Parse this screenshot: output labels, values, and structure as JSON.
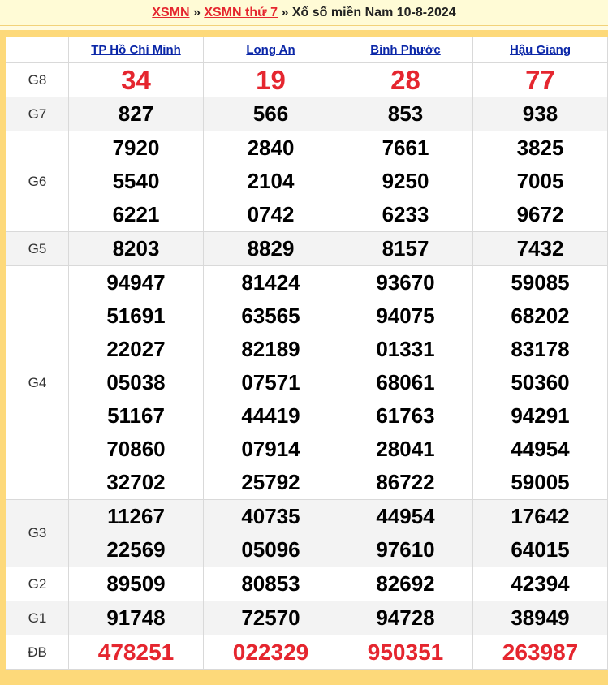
{
  "breadcrumb": {
    "home": "XSMN",
    "sep1": " » ",
    "day": "XSMN thứ 7",
    "sep2": " » ",
    "title": "Xổ số miền Nam 10-8-2024"
  },
  "provinces": [
    "TP Hồ Chí Minh",
    "Long An",
    "Bình Phước",
    "Hậu Giang"
  ],
  "rows": [
    {
      "label": "G8",
      "values": [
        [
          "34"
        ],
        [
          "19"
        ],
        [
          "28"
        ],
        [
          "77"
        ]
      ]
    },
    {
      "label": "G7",
      "values": [
        [
          "827"
        ],
        [
          "566"
        ],
        [
          "853"
        ],
        [
          "938"
        ]
      ]
    },
    {
      "label": "G6",
      "values": [
        [
          "7920",
          "5540",
          "6221"
        ],
        [
          "2840",
          "2104",
          "0742"
        ],
        [
          "7661",
          "9250",
          "6233"
        ],
        [
          "3825",
          "7005",
          "9672"
        ]
      ]
    },
    {
      "label": "G5",
      "values": [
        [
          "8203"
        ],
        [
          "8829"
        ],
        [
          "8157"
        ],
        [
          "7432"
        ]
      ]
    },
    {
      "label": "G4",
      "values": [
        [
          "94947",
          "51691",
          "22027",
          "05038",
          "51167",
          "70860",
          "32702"
        ],
        [
          "81424",
          "63565",
          "82189",
          "07571",
          "44419",
          "07914",
          "25792"
        ],
        [
          "93670",
          "94075",
          "01331",
          "68061",
          "61763",
          "28041",
          "86722"
        ],
        [
          "59085",
          "68202",
          "83178",
          "50360",
          "94291",
          "44954",
          "59005"
        ]
      ]
    },
    {
      "label": "G3",
      "values": [
        [
          "11267",
          "22569"
        ],
        [
          "40735",
          "05096"
        ],
        [
          "44954",
          "97610"
        ],
        [
          "17642",
          "64015"
        ]
      ]
    },
    {
      "label": "G2",
      "values": [
        [
          "89509"
        ],
        [
          "80853"
        ],
        [
          "82692"
        ],
        [
          "42394"
        ]
      ]
    },
    {
      "label": "G1",
      "values": [
        [
          "91748"
        ],
        [
          "72570"
        ],
        [
          "94728"
        ],
        [
          "38949"
        ]
      ]
    },
    {
      "label": "ĐB",
      "values": [
        [
          "478251"
        ],
        [
          "022329"
        ],
        [
          "950351"
        ],
        [
          "263987"
        ]
      ]
    }
  ]
}
